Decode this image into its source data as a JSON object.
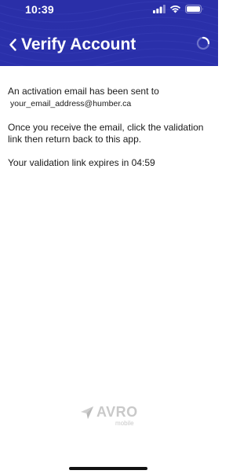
{
  "status_bar": {
    "time": "10:39",
    "icons": [
      "signal-icon",
      "wifi-icon",
      "battery-icon"
    ]
  },
  "header": {
    "back_icon": "chevron-left-icon",
    "title": "Verify Account",
    "spinner_icon": "loading-spinner-icon",
    "background_color": "#2a30ab"
  },
  "content": {
    "line1": "An activation email has been sent to",
    "email": "your_email_address@humber.ca",
    "instruction": "Once you receive the email, click the validation link then return back to this app.",
    "expiry_prefix": "Your validation link expires in",
    "expiry_time": "04:59"
  },
  "footer": {
    "logo_word": "AVRO",
    "logo_sub": "mobile"
  }
}
